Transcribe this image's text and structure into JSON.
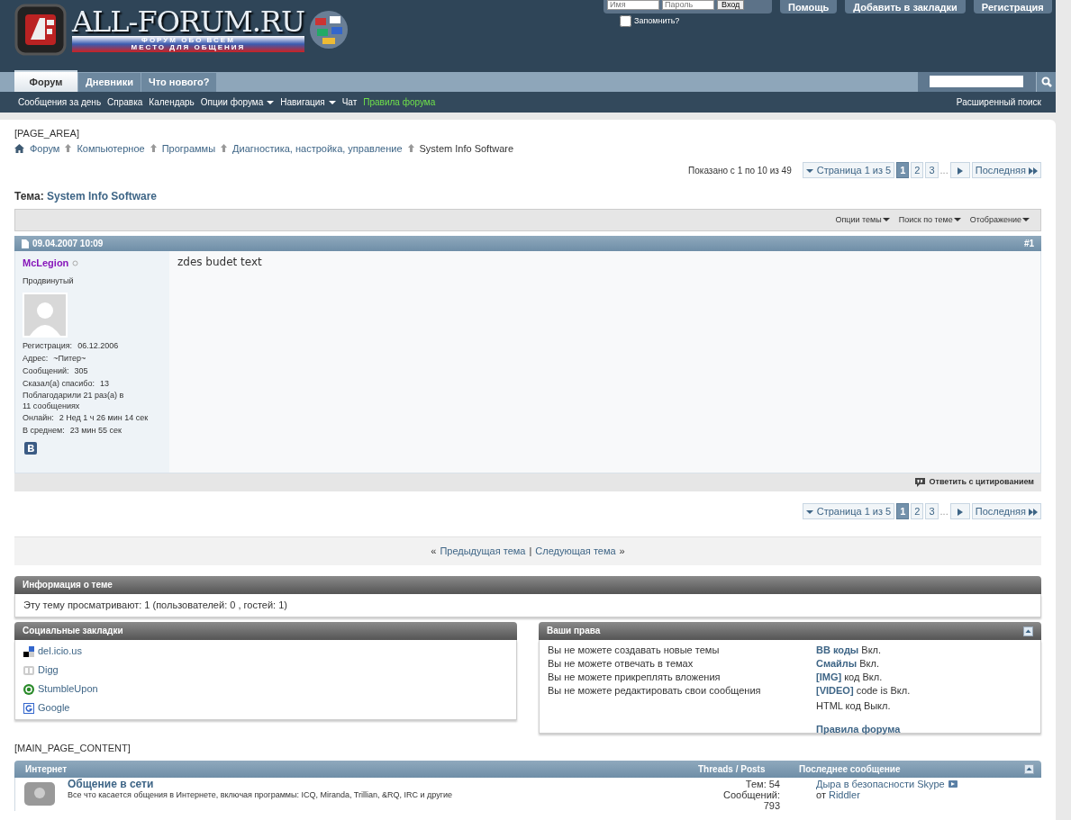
{
  "header": {
    "logo_title": "ALL-FORUM.RU",
    "logo_tagline": [
      "ФОРУМ ОБО ВСЕМ",
      "МЕСТО ДЛЯ ОБЩЕНИЯ"
    ],
    "login": {
      "username_placeholder": "Имя",
      "password_placeholder": "Пароль",
      "submit": "Вход",
      "remember": {
        "label": "Запомнить?",
        "checked": false
      }
    },
    "buttons": [
      "Помощь",
      "Добавить в закладки",
      "Регистрация"
    ]
  },
  "tabs": [
    {
      "label": "Форум",
      "selected": true
    },
    {
      "label": "Дневники",
      "selected": false
    },
    {
      "label": "Что нового?",
      "selected": false
    }
  ],
  "subnav": [
    {
      "label": "Сообщения за день",
      "kind": "link"
    },
    {
      "label": "Справка",
      "kind": "link"
    },
    {
      "label": "Календарь",
      "kind": "link"
    },
    {
      "label": "Опции форума",
      "kind": "menu"
    },
    {
      "label": "Навигация",
      "kind": "menu"
    },
    {
      "label": "Чат",
      "kind": "link"
    },
    {
      "label": "Правила форума",
      "kind": "highlight"
    }
  ],
  "advanced_search": "Расширенный поиск",
  "page_area_label": "[PAGE_AREA]",
  "breadcrumb": [
    "Форум",
    "Компьютерное",
    "Программы",
    "Диагностика, настройка, управление",
    "System Info Software"
  ],
  "results_summary": "Показано с 1 по 10 из 49",
  "paginations": [
    {
      "label": "Страница 1 из 5",
      "pages": [
        {
          "label": "1",
          "selected": true
        },
        {
          "label": "2",
          "selected": false
        },
        {
          "label": "3",
          "selected": false
        }
      ],
      "ellipsis": "...",
      "last": "Последняя"
    },
    {
      "label": "Страница 1 из 5",
      "pages": [
        {
          "label": "1",
          "selected": true
        },
        {
          "label": "2",
          "selected": false
        },
        {
          "label": "3",
          "selected": false
        }
      ],
      "ellipsis": "...",
      "last": "Последняя"
    }
  ],
  "thread": {
    "prefix": "Тема:",
    "title": "System Info Software",
    "tools": [
      "Опции темы",
      "Поиск по теме",
      "Отображение"
    ]
  },
  "post": {
    "date": "09.04.2007 10:09",
    "number": "#1",
    "author": "McLegion",
    "online": false,
    "rank": "Продвинутый",
    "stats": [
      {
        "kind": "stat",
        "label": "Регистрация:",
        "value": "06.12.2006"
      },
      {
        "kind": "stat",
        "label": "Адрес:",
        "value": "~Питер~"
      },
      {
        "kind": "stat",
        "label": "Сообщений:",
        "value": "305"
      },
      {
        "kind": "stat",
        "label": "Сказал(а) спасибо:",
        "value": "13"
      },
      {
        "kind": "note",
        "label": "Поблагодарили 21 раз(а) в 11 сообщениях"
      },
      {
        "kind": "stat",
        "label": "Онлайн:",
        "value": "2 Нед 1 ч 26 мин 14 сек"
      },
      {
        "kind": "stat",
        "label": "В среднем:",
        "value": "23 мин 55 сек"
      }
    ],
    "body": "zdes budet text",
    "reply": "Ответить с цитированием"
  },
  "thread_nav": {
    "prev_mark": "«",
    "prev": "Предыдущая тема",
    "separator": "|",
    "next": "Следующая тема",
    "next_mark": "»"
  },
  "info": {
    "title": "Информация о теме",
    "viewers": "Эту тему просматривают: 1 (пользователей: 0 , гостей: 1)"
  },
  "social": {
    "title": "Социальные закладки",
    "items": [
      {
        "label": "del.icio.us",
        "kind": "delicious"
      },
      {
        "label": "Digg",
        "kind": "digg"
      },
      {
        "label": "StumbleUpon",
        "kind": "stumble"
      },
      {
        "label": "Google",
        "kind": "google"
      }
    ]
  },
  "rights": {
    "title": "Ваши права",
    "lines": [
      "Вы не можете создавать новые темы",
      "Вы не можете отвечать в темах",
      "Вы не можете прикреплять вложения",
      "Вы не можете редактировать свои сообщения"
    ],
    "codes": [
      {
        "link": "BB коды",
        "text": "Вкл."
      },
      {
        "link": "Смайлы",
        "text": "Вкл."
      },
      {
        "link": "[IMG]",
        "text": "код Вкл."
      },
      {
        "link": "[VIDEO]",
        "text": "code is Вкл."
      },
      {
        "text": "HTML код Выкл."
      }
    ],
    "rules": "Правила форума"
  },
  "main_label": "[MAIN_PAGE_CONTENT]",
  "forum_table": {
    "columns": [
      "Интернет",
      "Threads / Posts",
      "Последнее сообщение"
    ],
    "rows": [
      {
        "title": "Общение в сети",
        "description": "Все что касается общения в Интернете, включая программы: ICQ, Miranda, Trillian, &RQ, IRC и другие",
        "threads": "Тем: 54",
        "posts": "Сообщений: 793",
        "last_title": "Дыра в безопасности Skype",
        "by": "от",
        "last_user": "Riddler"
      }
    ]
  }
}
